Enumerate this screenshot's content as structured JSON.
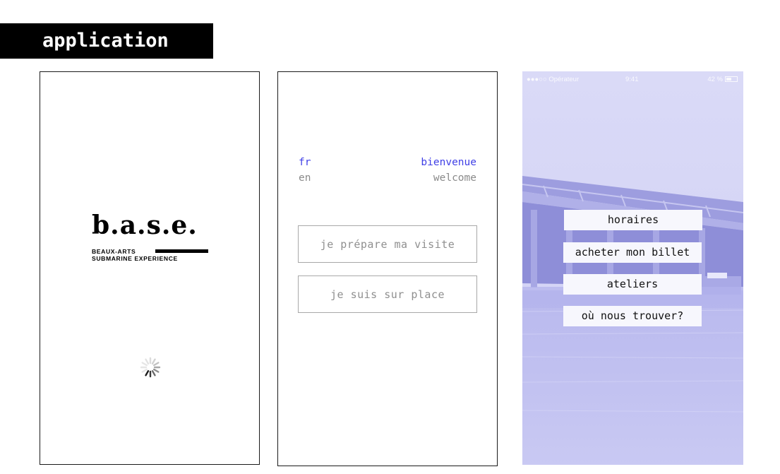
{
  "header": {
    "label": "application"
  },
  "splash": {
    "logo_word": "b.a.s.e.",
    "logo_line1": "BEAUX-ARTS",
    "logo_line2": "SUBMARINE EXPERIENCE",
    "loading_icon": "spinner-icon"
  },
  "language": {
    "languages": [
      {
        "code": "fr",
        "greeting": "bienvenue",
        "selected": true
      },
      {
        "code": "en",
        "greeting": "welcome",
        "selected": false
      }
    ],
    "buttons": {
      "prepare": "je prépare ma visite",
      "onsite": "je suis sur place"
    },
    "colors": {
      "accent": "#3f3fe6",
      "muted": "#8a8a8a"
    }
  },
  "menu": {
    "status_bar": {
      "carrier": "●●●○○ Opérateur",
      "time": "9:41",
      "battery": "42 %"
    },
    "items": [
      "horaires",
      "acheter mon billet",
      "ateliers",
      "où nous trouver?"
    ],
    "tint_color": "#cdcdf5"
  }
}
